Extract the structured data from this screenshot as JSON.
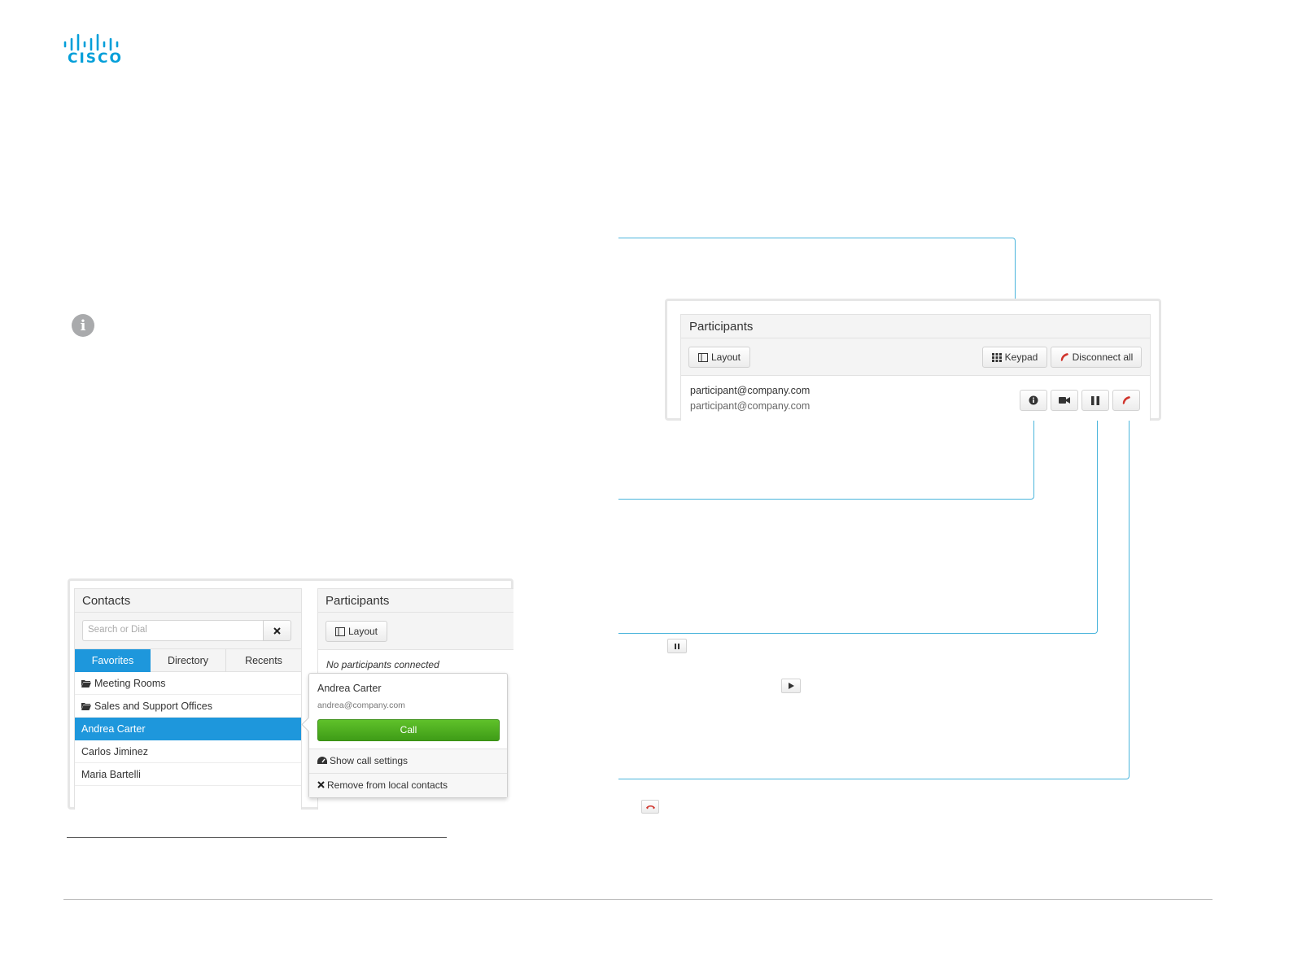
{
  "brand": {
    "logo_text": "CISCO",
    "color": "#049fd9"
  },
  "info_icon": "info-icon",
  "participants_detail": {
    "title": "Participants",
    "layout_label": "Layout",
    "keypad_label": "Keypad",
    "disconnect_all_label": "Disconnect all",
    "participant": {
      "address": "participant@company.com",
      "subaddress": "participant@company.com"
    },
    "row_icons": [
      "info-icon",
      "camera-icon",
      "pause-icon",
      "hangup-icon"
    ]
  },
  "contacts_panel": {
    "title": "Contacts",
    "search_placeholder": "Search or Dial",
    "tabs": [
      "Favorites",
      "Directory",
      "Recents"
    ],
    "active_tab": "Favorites",
    "items": [
      {
        "label": "Meeting Rooms",
        "icon": "folder-icon"
      },
      {
        "label": "Sales and Support Offices",
        "icon": "folder-icon"
      },
      {
        "label": "Andrea Carter",
        "icon": ""
      },
      {
        "label": "Carlos Jiminez",
        "icon": ""
      },
      {
        "label": "Maria Bartelli",
        "icon": ""
      }
    ],
    "selected_item": "Andrea Carter"
  },
  "participants_small": {
    "title": "Participants",
    "layout_label": "Layout",
    "empty_text": "No participants connected"
  },
  "contact_popover": {
    "name": "Andrea Carter",
    "email": "andrea@company.com",
    "call_label": "Call",
    "show_settings_label": "Show call settings",
    "remove_label": "Remove from local contacts"
  },
  "inline_icons": [
    "pause-icon",
    "play-icon",
    "hangup-icon"
  ],
  "colors": {
    "accent": "#1e97dc",
    "callout": "#4bb5dc",
    "call_green": "#4aa81e",
    "hangup_red": "#d0342c"
  }
}
